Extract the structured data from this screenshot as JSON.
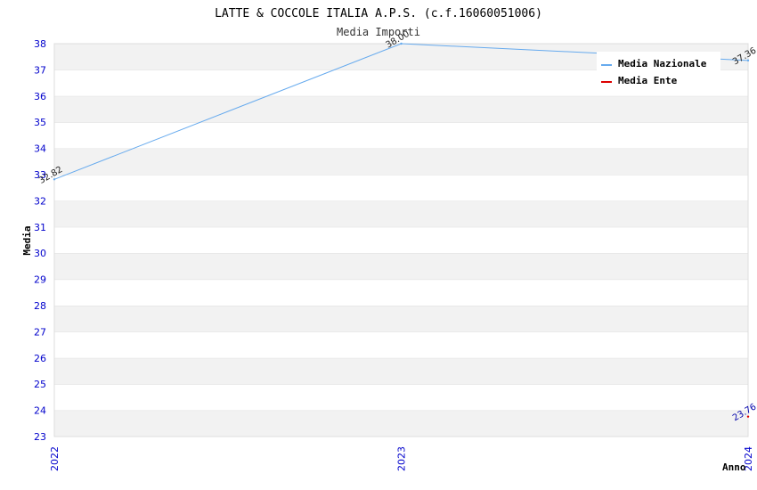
{
  "chart_data": {
    "type": "line",
    "title": "LATTE & COCCOLE ITALIA A.P.S. (c.f.16060051006)",
    "subtitle": "Media Importi",
    "xlabel": "Anno",
    "ylabel": "Media",
    "x": [
      "2022",
      "2023",
      "2024"
    ],
    "ylim": [
      23,
      38
    ],
    "yticks": [
      23,
      24,
      25,
      26,
      27,
      28,
      29,
      30,
      31,
      32,
      33,
      34,
      35,
      36,
      37,
      38
    ],
    "grid": true,
    "legend_position": "top-right",
    "series": [
      {
        "name": "Media Nazionale",
        "color": "#66aaee",
        "values": [
          32.82,
          38.0,
          37.36
        ],
        "labels": [
          "32.82",
          "38.00",
          "37.36"
        ]
      },
      {
        "name": "Media Ente",
        "color": "#dd0000",
        "values": [
          null,
          null,
          23.76
        ],
        "labels": [
          "",
          "",
          "23.76"
        ]
      }
    ]
  }
}
